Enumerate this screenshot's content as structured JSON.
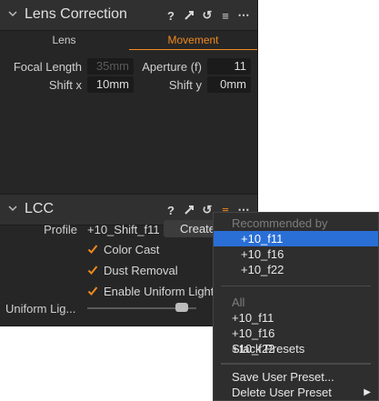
{
  "lens_correction": {
    "title": "Lens Correction",
    "tabs": [
      {
        "label": "Lens"
      },
      {
        "label": "Movement"
      }
    ],
    "focal_length": {
      "label": "Focal Length",
      "value": "35mm"
    },
    "aperture": {
      "label": "Aperture (f)",
      "value": "11"
    },
    "shift_x": {
      "label": "Shift  x",
      "value": "10mm"
    },
    "shift_y": {
      "label": "Shift  y",
      "value": "0mm"
    }
  },
  "lcc": {
    "title": "LCC",
    "profile": {
      "label": "Profile",
      "value": "+10_Shift_f11",
      "create": "Create"
    },
    "checkboxes": [
      {
        "label": "Color Cast",
        "checked": true
      },
      {
        "label": "Dust Removal",
        "checked": true
      },
      {
        "label": "Enable Uniform Light",
        "checked": true
      }
    ],
    "uniform_light": {
      "label": "Uniform Lig...",
      "level": 0.88
    }
  },
  "icons": {
    "help": "?",
    "reset_arrow": "↺",
    "menu": "≡",
    "more": "⋯"
  },
  "colors": {
    "accent": "#f08a1e",
    "selection": "#2a6fd6"
  },
  "dropdown": {
    "recommended_header": "Recommended by Relevance",
    "recommended": [
      "+10_f11",
      "+10_f16",
      "+10_f22"
    ],
    "all_header": "All",
    "all": [
      "+10_f11",
      "+10_f16",
      "+10_f22"
    ],
    "stack_presets": "Stack Presets",
    "save_user_preset": "Save User Preset...",
    "delete_user_preset": "Delete User Preset"
  }
}
